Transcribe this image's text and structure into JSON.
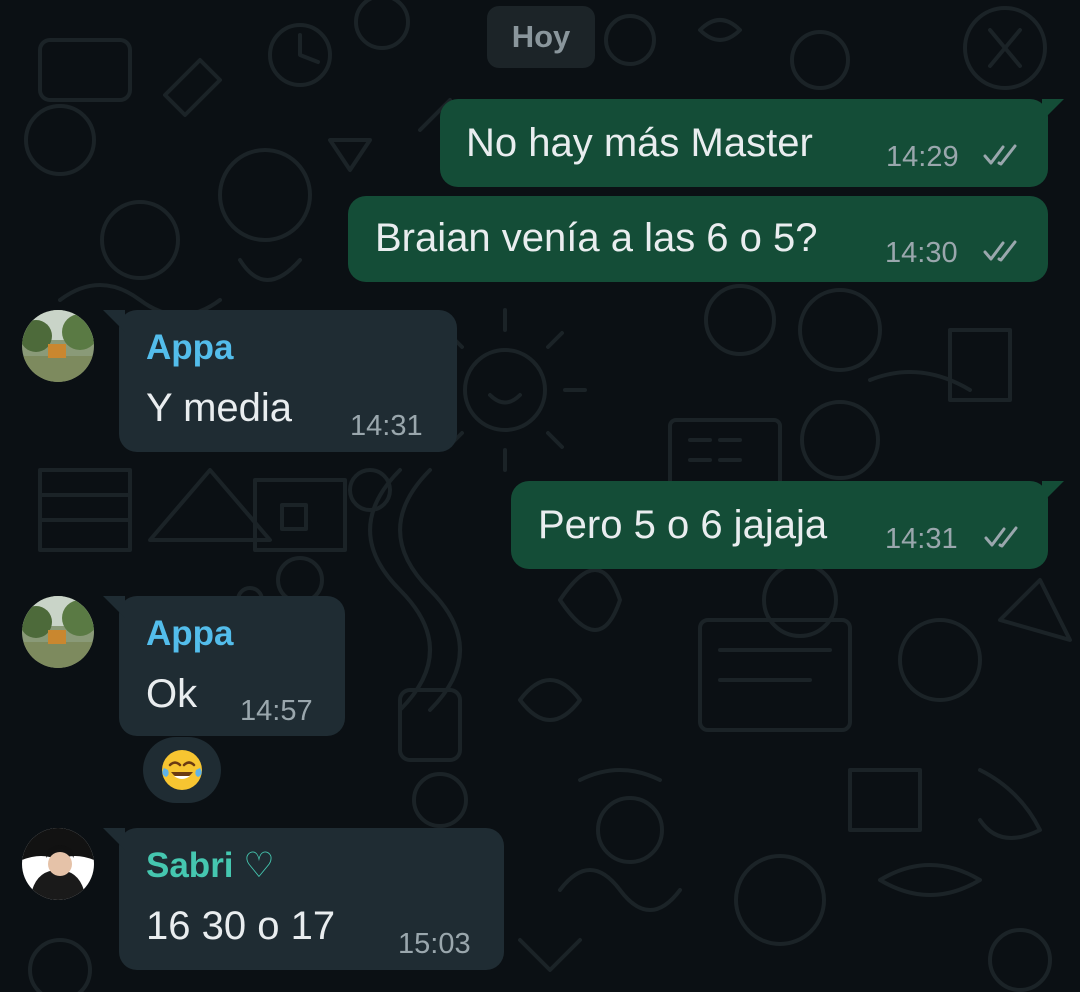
{
  "date_chip": "Hoy",
  "messages": [
    {
      "text": "No hay más Master",
      "time": "14:29"
    },
    {
      "text": "Braian venía a las 6 o 5?",
      "time": "14:30"
    },
    {
      "sender": "Appa",
      "text": "Y media",
      "time": "14:31"
    },
    {
      "text": "Pero 5 o 6 jajaja",
      "time": "14:31"
    },
    {
      "sender": "Appa",
      "text": "Ok",
      "time": "14:57"
    },
    {
      "sender": "Sabri ♡",
      "text": "16 30 o 17",
      "time": "15:03"
    }
  ],
  "reaction_emoji": "😂",
  "colors": {
    "background": "#0b1014",
    "outgoing_bubble": "#144d37",
    "incoming_bubble": "#1f2c33",
    "appa_name": "#53bdeb",
    "sabri_name": "#45c7b0",
    "read_ticks": "#9aa7ad"
  },
  "icons": [
    "double-check-icon",
    "contact-avatar-appa",
    "contact-avatar-sabri",
    "doodle-wallpaper"
  ]
}
